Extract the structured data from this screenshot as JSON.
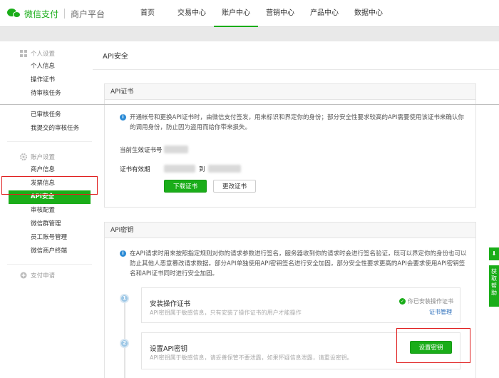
{
  "header": {
    "brand": "微信支付",
    "brand_sub": "商户平台",
    "nav": [
      {
        "label": "首页"
      },
      {
        "label": "交易中心"
      },
      {
        "label": "账户中心"
      },
      {
        "label": "营销中心"
      },
      {
        "label": "产品中心"
      },
      {
        "label": "数据中心"
      }
    ],
    "active_nav": "账户中心"
  },
  "sidebar": {
    "group_personal": {
      "title": "个人设置",
      "items": [
        {
          "label": "个人信息"
        },
        {
          "label": "操作证书"
        },
        {
          "label": "待审核任务"
        },
        {
          "label": "已审核任务"
        },
        {
          "label": "我提交的审核任务"
        }
      ]
    },
    "group_account": {
      "title": "账户设置",
      "items": [
        {
          "label": "商户信息"
        },
        {
          "label": "发票信息"
        },
        {
          "label": "API安全"
        },
        {
          "label": "审核配置"
        },
        {
          "label": "微信群管理"
        },
        {
          "label": "员工账号管理"
        },
        {
          "label": "微信商户终端"
        }
      ]
    },
    "group_apply": {
      "title": "支付申请"
    },
    "active_item": "API安全"
  },
  "main": {
    "title": "API安全",
    "cert_panel": {
      "title": "API证书",
      "notice": "开通帐号和更换API证书时，由微信支付签发，用来标识和界定你的身份；部分安全性要求较高的API需要使用该证书来确认你的调用身份，防止因为盗用而给你带来损失。",
      "serial_label": "当前生效证书号",
      "validity_label": "证书有效期",
      "validity_to": "到",
      "download_button": "下载证书",
      "change_button": "更改证书"
    },
    "key_panel": {
      "title": "API密钥",
      "notice": "在API请求时用来按照指定规则对你的请求参数进行签名，服务器收到你的请求时会进行签名验证，既可以界定你的身份也可以防止其他人恶意篡改请求数据。部分API单独使用API密钥签名进行安全加固，部分安全性要求更高的API会要求使用API密钥签名和API证书同时进行安全加固。",
      "steps": [
        {
          "number": "1",
          "title": "安装操作证书",
          "desc": "API密钥属于敏感信息，只有安装了操作证书的用户才能操作",
          "status": "你已安装操作证书",
          "link": "证书管理"
        },
        {
          "number": "2",
          "title": "设置API密钥",
          "desc": "API密钥属于敏感信息，请妥善保管不要泄露，如果怀疑信息泄露，请重设密钥。",
          "button": "设置密钥"
        }
      ]
    }
  },
  "right_tabs": {
    "download_icon": "download-icon",
    "help_text": "获取帮助"
  },
  "colors": {
    "brand_green": "#1aad19",
    "info_blue": "#2a8ad5",
    "highlight_red": "#e02020"
  }
}
